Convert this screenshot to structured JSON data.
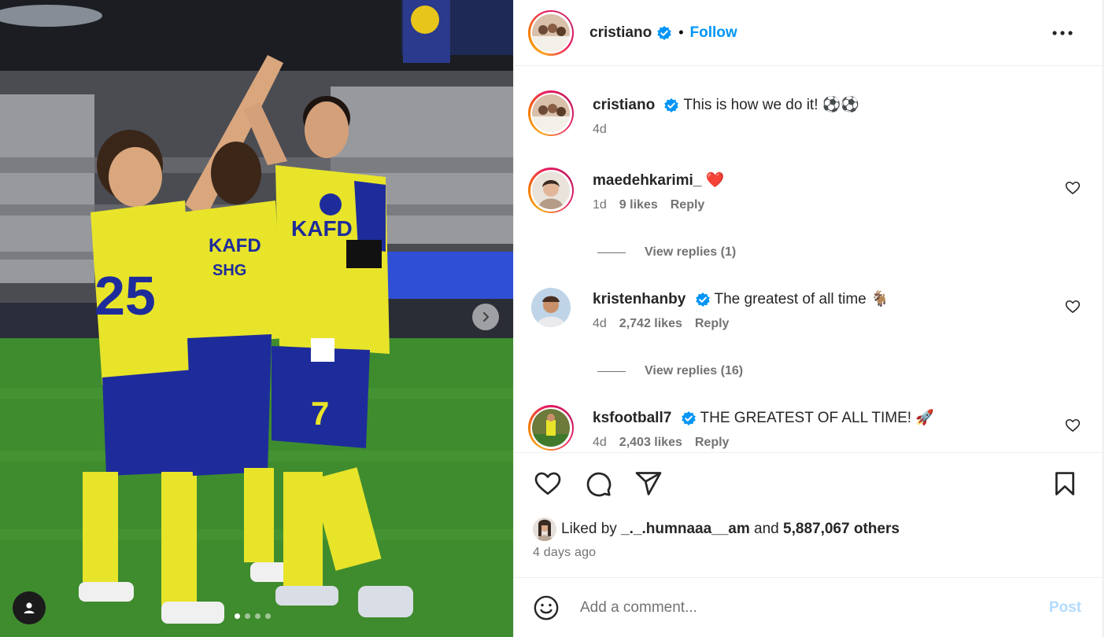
{
  "post": {
    "author": "cristiano",
    "follow_label": "Follow",
    "separator": "•",
    "caption": "This is how we do it! ⚽⚽",
    "caption_age": "4d"
  },
  "comments": [
    {
      "username": "maedehkarimi_",
      "verified": false,
      "text": "❤️",
      "age": "1d",
      "likes": "9 likes",
      "reply_label": "Reply",
      "view_replies": "View replies (1)"
    },
    {
      "username": "kristenhanby",
      "verified": true,
      "text": "The greatest of all time 🐐",
      "age": "4d",
      "likes": "2,742 likes",
      "reply_label": "Reply",
      "view_replies": "View replies (16)"
    },
    {
      "username": "ksfootball7",
      "verified": true,
      "text": "THE GREATEST OF ALL TIME! 🚀",
      "age": "4d",
      "likes": "2,403 likes",
      "reply_label": "Reply"
    }
  ],
  "likes": {
    "prefix": "Liked by",
    "liker": "_._.humnaaa__am",
    "and": "and",
    "others": "5,887,067 others"
  },
  "posted_time": "4 days ago",
  "comment_box": {
    "placeholder": "Add a comment...",
    "post_label": "Post"
  },
  "carousel": {
    "total_slides": 4,
    "active_index": 0
  },
  "colors": {
    "accent": "#0095f6",
    "post_disabled": "#b3dbff",
    "muted": "#737373"
  },
  "icons": [
    "verified-badge-icon",
    "more-options-icon",
    "heart-icon",
    "comment-icon",
    "share-icon",
    "save-icon",
    "emoji-icon",
    "chevron-right-icon",
    "user-tag-icon"
  ]
}
